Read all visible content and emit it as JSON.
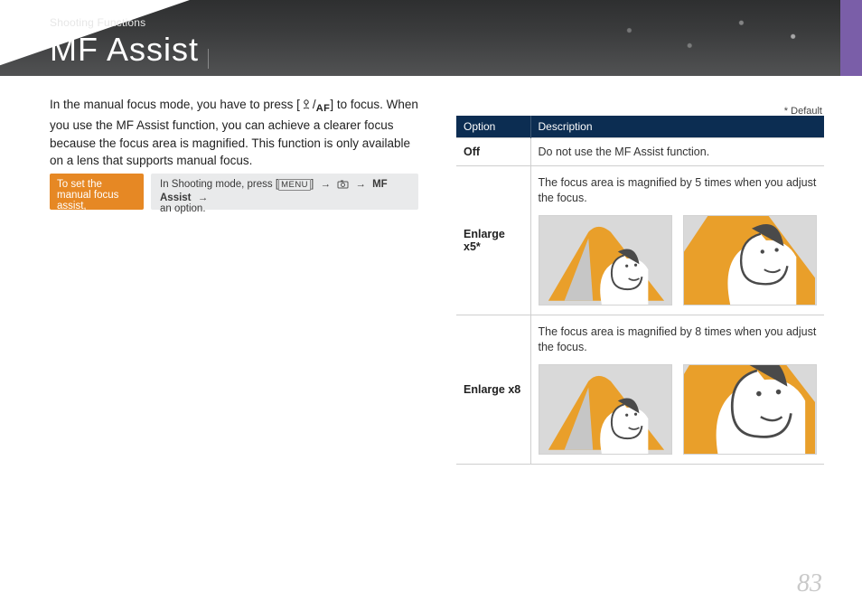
{
  "header": {
    "breadcrumb": "Shooting Functions",
    "title": "MF Assist"
  },
  "intro": {
    "part1": "In the manual focus mode, you have to press [",
    "part2": "/",
    "part3": "] to focus. When you use the MF Assist function, you can achieve a clearer focus because the focus area is magnified. This function is only available on a lens that supports manual focus.",
    "af_label": "AF"
  },
  "callouts": {
    "orange": "To set the manual focus assist,",
    "grey_part1": "In Shooting mode, press [",
    "grey_menu": "MENU",
    "grey_part2": "]",
    "grey_bold": "MF Assist",
    "grey_part3": "an option."
  },
  "default_note": "* Default",
  "table": {
    "headers": {
      "option": "Option",
      "description": "Description"
    },
    "rows": {
      "off": {
        "option": "Off",
        "description": "Do not use the MF Assist function."
      },
      "x5": {
        "option": "Enlarge x5*",
        "description": "The focus area is magnified by 5 times when you adjust the focus."
      },
      "x8": {
        "option": "Enlarge x8",
        "description": "The focus area is magnified by 8 times when you adjust the focus."
      }
    }
  },
  "page_number": "83"
}
